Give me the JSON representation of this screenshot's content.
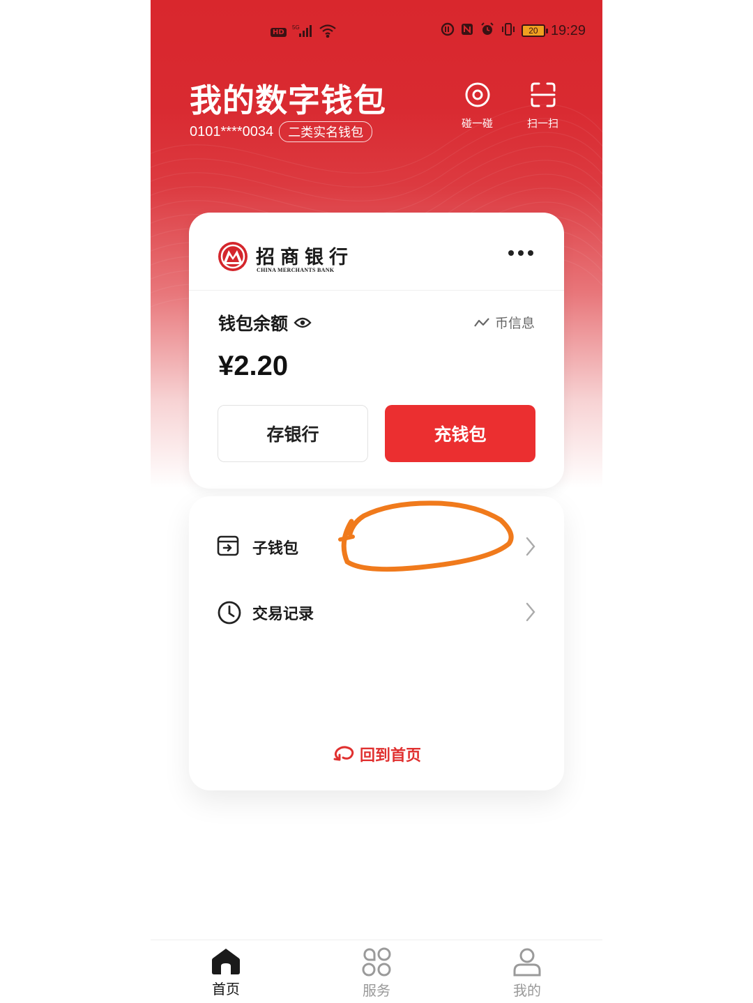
{
  "status_bar": {
    "left_badge": "HD",
    "network": "5G",
    "battery": "20",
    "time": "19:29"
  },
  "header": {
    "title": "我的数字钱包",
    "account": "0101****0034",
    "wallet_type": "二类实名钱包",
    "actions": [
      {
        "label": "碰一碰",
        "icon": "nfc-touch-icon"
      },
      {
        "label": "扫一扫",
        "icon": "scan-icon"
      }
    ]
  },
  "bank": {
    "name_cn": "招商银行",
    "name_en": "CHINA MERCHANTS BANK",
    "brand_color": "#d4262c"
  },
  "balance": {
    "label": "钱包余额",
    "coin_info": "币信息",
    "value": "¥2.20"
  },
  "buttons": {
    "deposit_bank": "存银行",
    "charge_wallet": "充钱包"
  },
  "menu": [
    {
      "label": "子钱包",
      "icon": "sub-wallet-icon"
    },
    {
      "label": "交易记录",
      "icon": "clock-icon"
    }
  ],
  "home_link": "回到首页",
  "bottom_nav": [
    {
      "label": "首页",
      "icon": "home-icon",
      "active": true
    },
    {
      "label": "服务",
      "icon": "services-grid-icon",
      "active": false
    },
    {
      "label": "我的",
      "icon": "user-icon",
      "active": false
    }
  ],
  "colors": {
    "header_red": "#d9272d",
    "primary_button": "#eb2f30",
    "annotation_orange": "#f07a1c"
  }
}
